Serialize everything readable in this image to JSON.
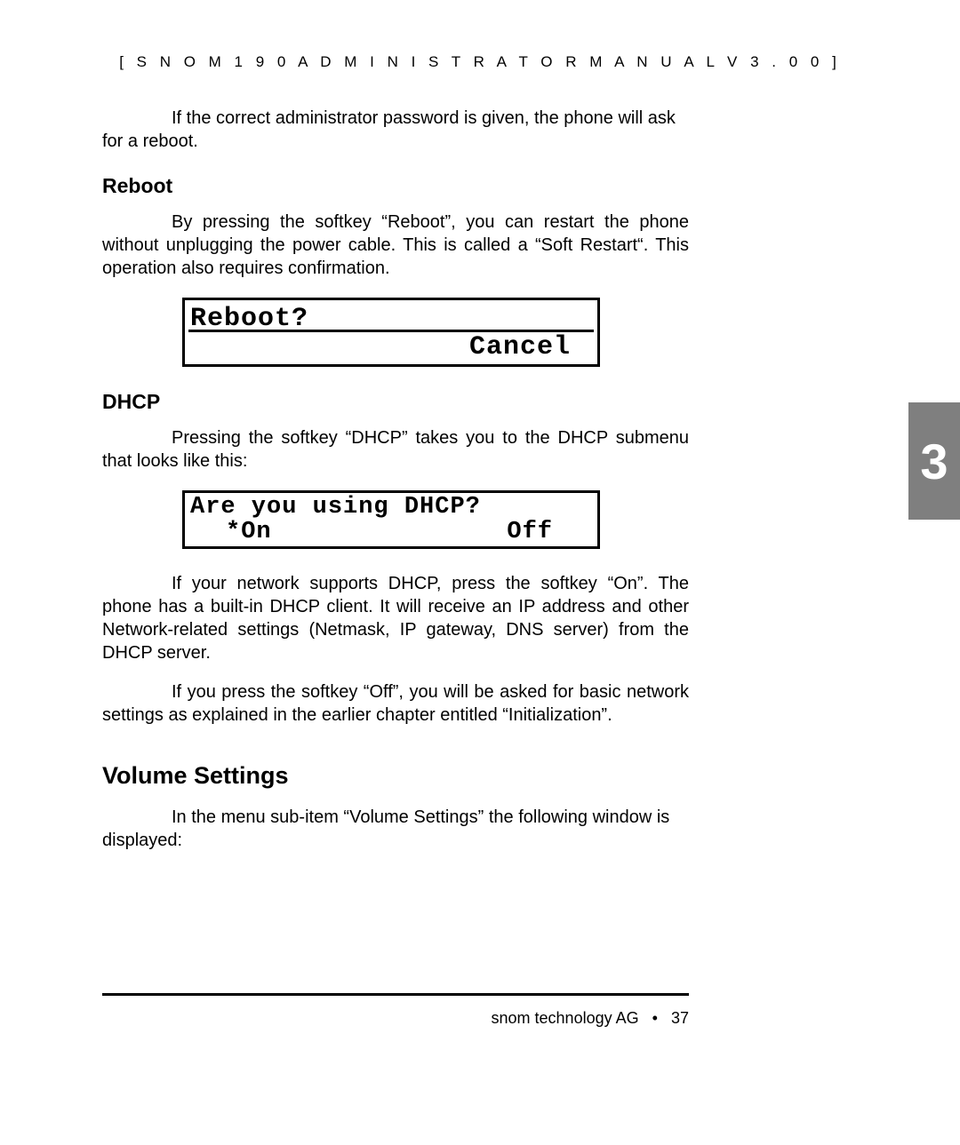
{
  "header": {
    "text_full": "[  S N O M   1 9 0   A D M I N I S T R A T O R   M A N U A L   V 3 . 0 0  ]"
  },
  "intro_paragraph": "If the correct administrator password is given, the phone will ask for a reboot.",
  "section_reboot": {
    "heading": "Reboot",
    "paragraph": "By pressing the softkey “Reboot”, you can restart the phone without unplugging the power cable. This is called a “Soft Restart“. This operation also requires confirmation.",
    "lcd": {
      "line1": "Reboot?",
      "softkey_right": "Cancel"
    }
  },
  "section_dhcp": {
    "heading": "DHCP",
    "paragraph1": "Pressing the softkey “DHCP” takes you to the DHCP submenu that looks like this:",
    "lcd": {
      "line1": "Are you using DHCP?",
      "option_left": "*On",
      "option_right": "Off"
    },
    "paragraph2": "If your network supports DHCP, press the softkey “On”. The phone has a built-in DHCP client. It will receive an IP address and other Network-related settings (Netmask, IP gateway, DNS server) from the DHCP server.",
    "paragraph3": "If you press the softkey “Off”, you will be asked for basic network settings as explained in the earlier chapter entitled “Initialization”."
  },
  "section_volume": {
    "heading": "Volume Settings",
    "paragraph": "In the menu sub-item “Volume Settings” the following window is displayed:"
  },
  "chapter_tab": "3",
  "footer": {
    "company": "snom technology AG",
    "separator": "•",
    "page_number": "37"
  }
}
